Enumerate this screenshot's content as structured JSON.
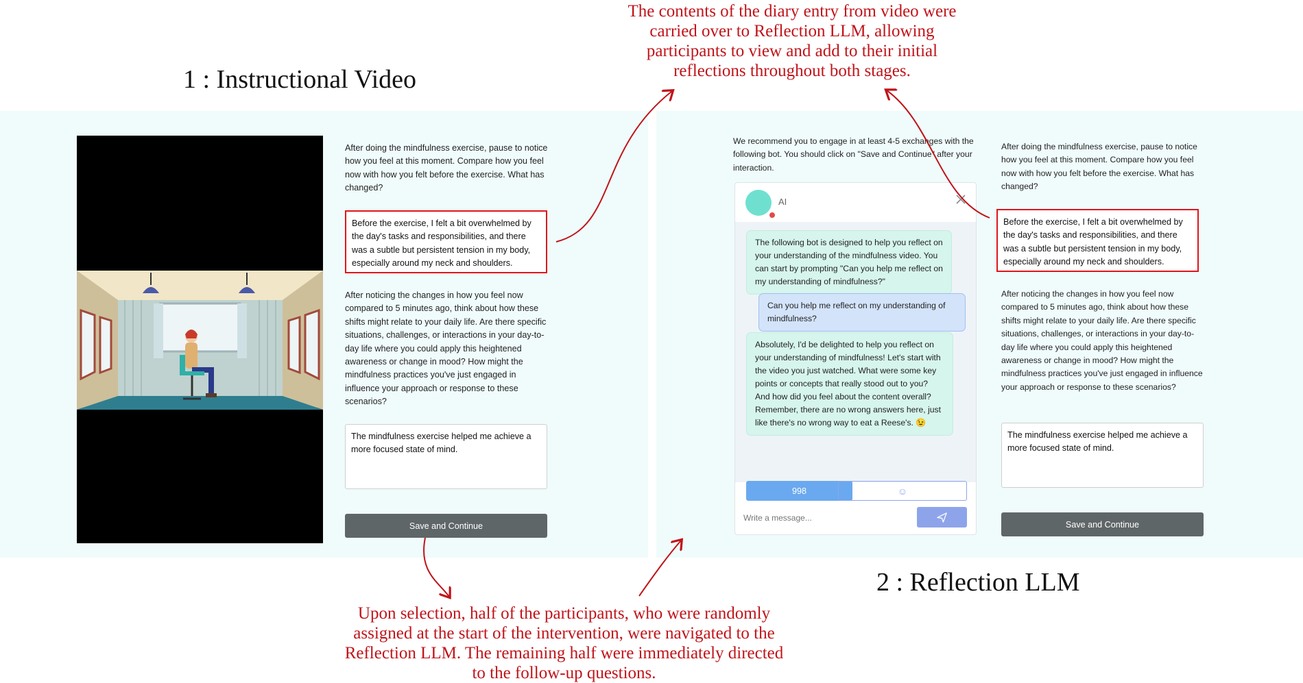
{
  "annotations": {
    "top_right": "The contents of the diary entry from video were carried over to Reflection LLM, allowing participants to view and add to their initial reflections throughout both stages.",
    "bottom": "Upon selection, half of the participants, who were randomly assigned at the start of the intervention, were navigated to the Reflection LLM. The remaining half were immediately directed to the follow-up questions."
  },
  "stage1": {
    "title": "1 : Instructional Video",
    "prompt1": "After doing the mindfulness exercise, pause to notice how you feel at this moment. Compare how you feel now with how you felt before the exercise. What has changed?",
    "answer1": "Before the exercise, I felt a bit overwhelmed by the day's tasks and responsibilities, and there was a subtle but persistent tension in my body, especially around my neck and shoulders.",
    "prompt2": "After noticing the changes in how you feel now compared to 5 minutes ago, think about how these shifts might relate to your daily life. Are there specific situations, challenges, or interactions in your day-to-day life where you could apply this heightened awareness or change in mood? How might the mindfulness practices you've just engaged in influence your approach or response to these scenarios?",
    "answer2": "The mindfulness exercise helped me achieve a more focused state of mind.",
    "save_label": "Save and Continue"
  },
  "stage2": {
    "title": "2 : Reflection LLM",
    "recommend": "We recommend you to engage in at least 4-5 exchanges with the following bot. You should click on \"Save and Continue\" after your interaction.",
    "chat": {
      "bot_name": "AI",
      "messages": [
        {
          "role": "bot",
          "text": "The following bot is designed to help you reflect on your understanding of the mindfulness video. You can start by prompting \"Can you help me reflect on my understanding of mindfulness?\""
        },
        {
          "role": "user",
          "text": "Can you help me reflect on my understanding of mindfulness?"
        },
        {
          "role": "bot",
          "text": "Absolutely, I'd be delighted to help you reflect on your understanding of mindfulness! Let's start with the video you just watched. What were some key points or concepts that really stood out to you? And how did you feel about the content overall? Remember, there are no wrong answers here, just like there's no wrong way to eat a Reese's. 😉"
        }
      ],
      "counter": "998",
      "emoji": "☺",
      "input_placeholder": "Write a message..."
    },
    "prompt1": "After doing the mindfulness exercise, pause to notice how you feel at this moment. Compare how you feel now with how you felt before the exercise. What has changed?",
    "answer1": "Before the exercise, I felt a bit overwhelmed by the day's tasks and responsibilities, and there was a subtle but persistent tension in my body, especially around my neck and shoulders.",
    "prompt2": "After noticing the changes in how you feel now compared to 5 minutes ago, think about how these shifts might relate to your daily life. Are there specific situations, challenges, or interactions in your day-to-day life where you could apply this heightened awareness or change in mood? How might the mindfulness practices you've just engaged in influence your approach or response to these scenarios?",
    "answer2": "The mindfulness exercise helped me achieve a more focused state of mind.",
    "save_label": "Save and Continue"
  },
  "colors": {
    "annotation_red": "#c0141a",
    "panel_bg": "#f0fbfb",
    "button_gray": "#5f6668",
    "counter_blue": "#6aa9ef",
    "send_purple": "#8ea4ea"
  }
}
